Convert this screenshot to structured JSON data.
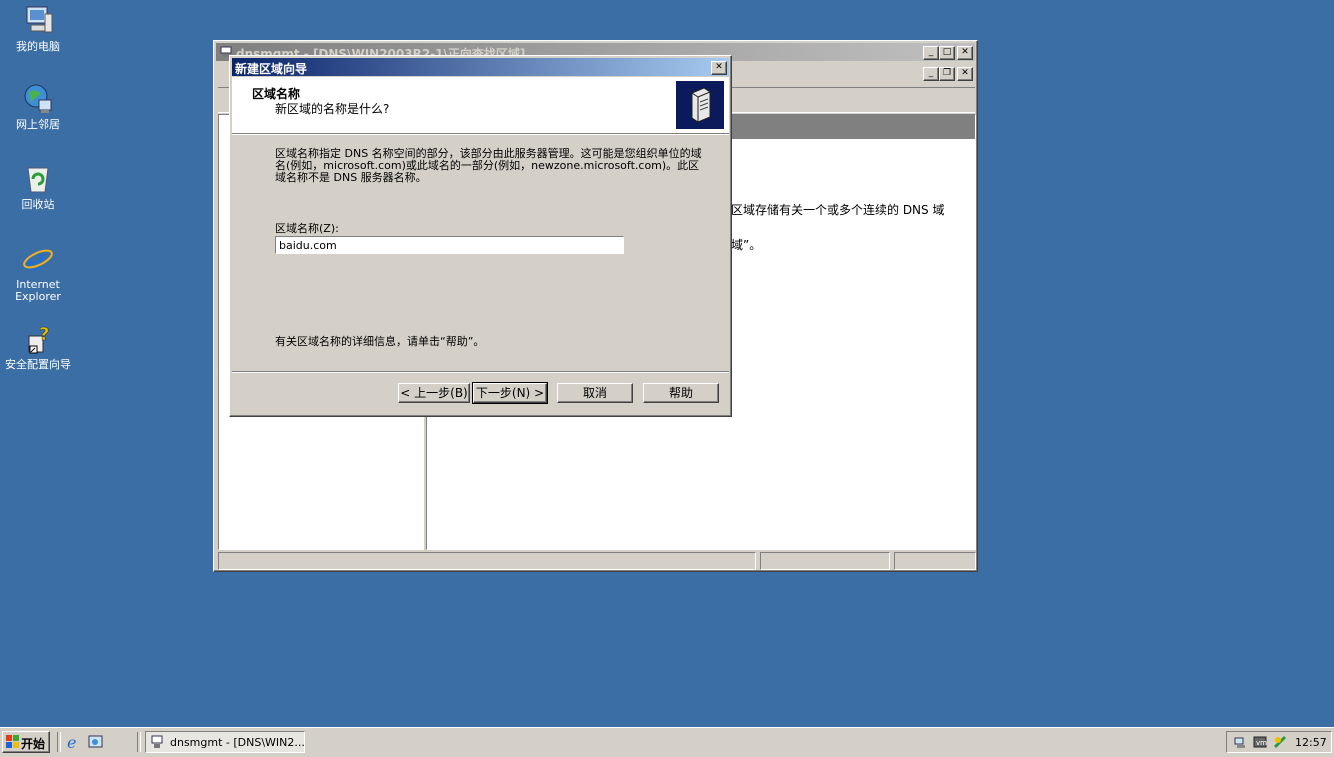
{
  "desktop": {
    "icons": [
      {
        "label": "我的电脑",
        "icon": "my-computer-icon"
      },
      {
        "label": "网上邻居",
        "icon": "network-places-icon"
      },
      {
        "label": "回收站",
        "icon": "recycle-bin-icon"
      },
      {
        "label": "Internet Explorer",
        "icon": "ie-icon"
      },
      {
        "label": "安全配置向导",
        "icon": "security-wizard-icon"
      }
    ]
  },
  "mmc": {
    "title": "dnsmgmt - [DNS\\WIN2003R2-1\\正向查找区域]",
    "right_text_1": "区域存储有关一个或多个连续的 DNS 域",
    "right_text_2": "域”。"
  },
  "wizard": {
    "title": "新建区域向导",
    "header_title": "区域名称",
    "header_subtitle": "新区域的名称是什么?",
    "description": "区域名称指定 DNS 名称空间的部分，该部分由此服务器管理。这可能是您组织单位的域名(例如，microsoft.com)或此域名的一部分(例如，newzone.microsoft.com)。此区域名称不是 DNS 服务器名称。",
    "zone_label": "区域名称(Z):",
    "zone_value": "baidu.com",
    "help_text": "有关区域名称的详细信息，请单击“帮助”。",
    "buttons": {
      "back": "< 上一步(B)",
      "next": "下一步(N) >",
      "cancel": "取消",
      "help": "帮助"
    }
  },
  "taskbar": {
    "start_label": "开始",
    "task_label": "dnsmgmt - [DNS\\WIN2...",
    "clock": "12:57"
  }
}
